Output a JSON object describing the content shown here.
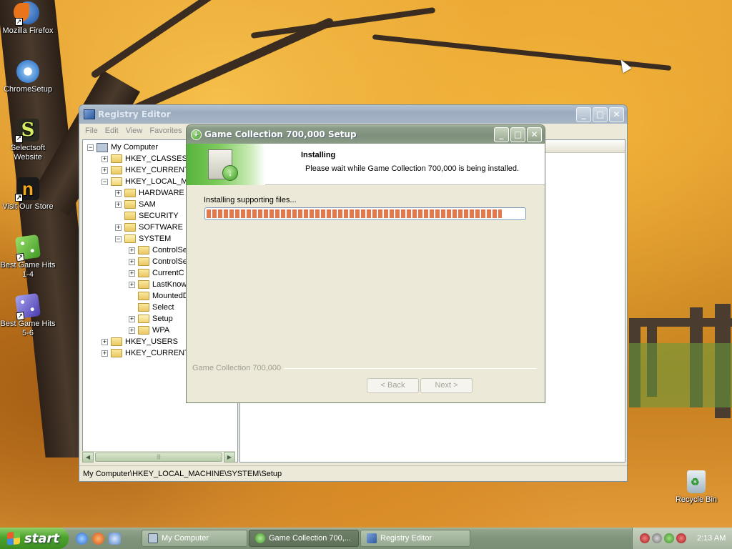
{
  "desktop": {
    "icons": [
      {
        "label": "Mozilla Firefox",
        "icon": "firefox-icon"
      },
      {
        "label": "ChromeSetup",
        "icon": "chrome-setup-icon"
      },
      {
        "label": "Selectsoft Website",
        "icon": "selectsoft-icon"
      },
      {
        "label": "Visit Our Store",
        "icon": "store-icon"
      },
      {
        "label": "Best Game Hits 1-4",
        "icon": "game-dice-green-icon"
      },
      {
        "label": "Best Game Hits 5-6",
        "icon": "game-dice-purple-icon"
      },
      {
        "label": "Recycle Bin",
        "icon": "recycle-bin-icon"
      }
    ]
  },
  "regedit": {
    "title": "Registry Editor",
    "menu": [
      "File",
      "Edit",
      "View",
      "Favorites"
    ],
    "tree": [
      {
        "label": "My Computer",
        "expander": "−"
      },
      {
        "label": "HKEY_CLASSES_R",
        "expander": "+"
      },
      {
        "label": "HKEY_CURRENT_",
        "expander": "+"
      },
      {
        "label": "HKEY_LOCAL_MA",
        "expander": "−"
      },
      {
        "label": "HARDWARE",
        "expander": "+"
      },
      {
        "label": "SAM",
        "expander": "+"
      },
      {
        "label": "SECURITY",
        "expander": ""
      },
      {
        "label": "SOFTWARE",
        "expander": "+"
      },
      {
        "label": "SYSTEM",
        "expander": "−"
      },
      {
        "label": "ControlSe",
        "expander": "+"
      },
      {
        "label": "ControlSe",
        "expander": "+"
      },
      {
        "label": "CurrentC",
        "expander": "+"
      },
      {
        "label": "LastKnow",
        "expander": "+"
      },
      {
        "label": "MountedD",
        "expander": ""
      },
      {
        "label": "Select",
        "expander": ""
      },
      {
        "label": "Setup",
        "expander": "+"
      },
      {
        "label": "WPA",
        "expander": "+"
      },
      {
        "label": "HKEY_USERS",
        "expander": "+"
      },
      {
        "label": "HKEY_CURRENT_",
        "expander": "+"
      }
    ],
    "status_path": "My Computer\\HKEY_LOCAL_MACHINE\\SYSTEM\\Setup"
  },
  "setup": {
    "title": "Game Collection 700,000 Setup",
    "heading": "Installing",
    "subheading": "Please wait while Game Collection 700,000 is being installed.",
    "status": "Installing supporting files...",
    "progress_percent": 93,
    "brand": "Game Collection 700,000",
    "back_label": "< Back",
    "next_label": "Next >"
  },
  "taskbar": {
    "start_label": "start",
    "tasks": [
      {
        "label": "My Computer",
        "active": false
      },
      {
        "label": "Game Collection 700,...",
        "active": true
      },
      {
        "label": "Registry Editor",
        "active": false
      }
    ],
    "clock": "2:13 AM"
  },
  "colors": {
    "progress": "#e7774a",
    "taskbar": "#7f937a",
    "start": "#4da32e"
  }
}
